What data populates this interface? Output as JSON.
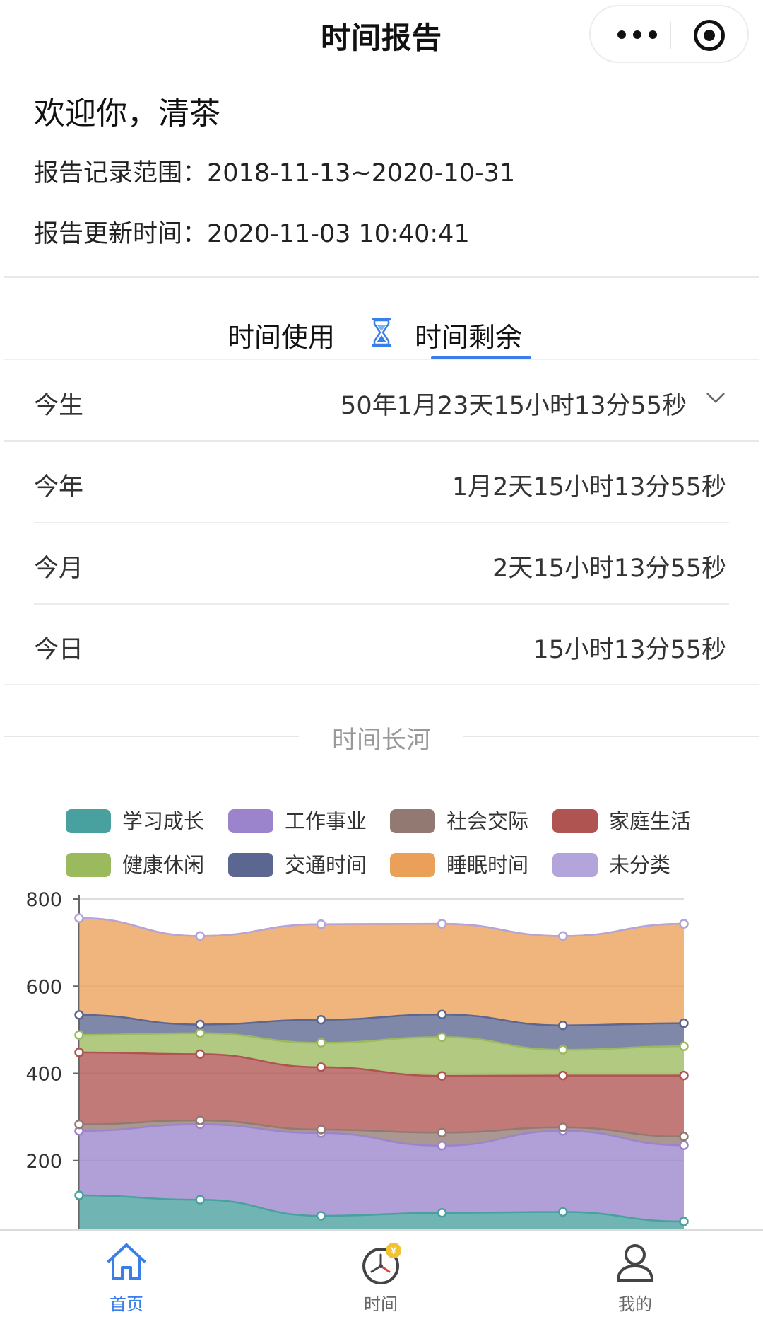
{
  "nav": {
    "title": "时间报告"
  },
  "header": {
    "welcome": "欢迎你，清茶",
    "range_line": "报告记录范围：2018-11-13~2020-10-31",
    "update_line": "报告更新时间：2020-11-03 10:40:41"
  },
  "tabs": {
    "usage": "时间使用",
    "remaining": "时间剩余",
    "active": "时间剩余"
  },
  "remaining": {
    "life": {
      "label": "今生",
      "value": "50年1月23天15小时13分55秒"
    },
    "year": {
      "label": "今年",
      "value": "1月2天15小时13分55秒"
    },
    "month": {
      "label": "今月",
      "value": "2天15小时13分55秒"
    },
    "day": {
      "label": "今日",
      "value": "15小时13分55秒"
    }
  },
  "section": {
    "title": "时间长河"
  },
  "chart_data": {
    "type": "area",
    "stacked": true,
    "title": "",
    "xlabel": "",
    "ylabel": "",
    "ylim": [
      0,
      800
    ],
    "yticks": [
      0,
      200,
      400,
      600,
      800
    ],
    "grid": true,
    "legend_position": "top",
    "series": [
      {
        "name": "学习成长",
        "color": "#48a09f",
        "values": [
          120,
          110,
          73,
          80,
          82,
          60
        ]
      },
      {
        "name": "工作事业",
        "color": "#9b84cc",
        "values": [
          148,
          173,
          190,
          154,
          186,
          175
        ]
      },
      {
        "name": "社会交际",
        "color": "#927a72",
        "values": [
          15,
          9,
          8,
          30,
          8,
          20
        ]
      },
      {
        "name": "家庭生活",
        "color": "#b05452",
        "values": [
          165,
          152,
          143,
          130,
          119,
          140
        ]
      },
      {
        "name": "健康休闲",
        "color": "#9bba5e",
        "values": [
          40,
          48,
          56,
          89,
          59,
          67
        ]
      },
      {
        "name": "交通时间",
        "color": "#5b6790",
        "values": [
          46,
          20,
          53,
          52,
          56,
          53
        ]
      },
      {
        "name": "睡眠时间",
        "color": "#eba059",
        "values": [
          222,
          203,
          219,
          208,
          205,
          228
        ]
      },
      {
        "name": "未分类",
        "color": "#b4a4dc",
        "values": [
          0,
          0,
          0,
          0,
          0,
          0
        ]
      }
    ]
  },
  "tabbar": {
    "active_color": "#3a7ee8",
    "inactive_color": "#666666",
    "items": [
      {
        "label": "首页",
        "icon": "home-icon",
        "active": true
      },
      {
        "label": "时间",
        "icon": "clock-icon",
        "active": false
      },
      {
        "label": "我的",
        "icon": "user-icon",
        "active": false
      }
    ]
  }
}
